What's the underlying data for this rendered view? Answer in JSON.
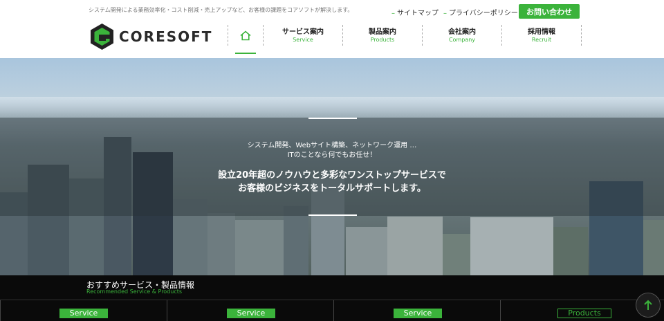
{
  "header": {
    "tagline": "システム開発による業務効率化・コスト削減・売上アップなど、お客様の課題をコアソフトが解決します。",
    "sitemap": "サイトマップ",
    "privacy": "プライバシーポリシー",
    "contact": "お問い合わせ",
    "logo_text": "CORESOFT"
  },
  "nav": {
    "home_icon": "home-icon",
    "items": [
      {
        "jp": "サービス案内",
        "en": "Service"
      },
      {
        "jp": "製品案内",
        "en": "Products"
      },
      {
        "jp": "会社案内",
        "en": "Company"
      },
      {
        "jp": "採用情報",
        "en": "Recruit"
      }
    ]
  },
  "hero": {
    "sub_line1": "システム開発、Webサイト構築、ネットワーク運用 …",
    "sub_line2": "ITのことなら何でもお任せ！",
    "main_line1": "設立20年超のノウハウと多彩なワンストップサービスで",
    "main_line2": "お客様のビジネスをトータルサポートします。"
  },
  "recommended": {
    "title": "おすすめサービス・製品情報",
    "subtitle": "Recommended Service & Products",
    "cards": [
      {
        "badge": "Service"
      },
      {
        "badge": "Service"
      },
      {
        "badge": "Service"
      },
      {
        "badge": "Products"
      }
    ]
  },
  "colors": {
    "accent": "#3bb33b",
    "dark": "#0a0a0a"
  },
  "icons": {
    "scroll_top": "arrow-up-icon"
  }
}
